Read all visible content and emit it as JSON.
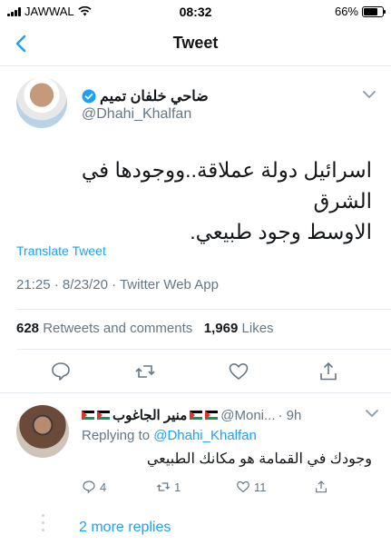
{
  "status_bar": {
    "carrier": "JAWWAL",
    "time": "08:32",
    "battery": "66%",
    "battery_level": 0.66
  },
  "nav": {
    "title": "Tweet"
  },
  "tweet": {
    "author_name": "ضاحي خلفان تميم",
    "author_handle": "@Dhahi_Khalfan",
    "text_line1": "اسرائيل دولة عملاقة..ووجودها في الشرق",
    "text_line2": "الاوسط وجود طبيعي.",
    "translate": "Translate Tweet",
    "meta": "21:25 · 8/23/20 · Twitter Web App",
    "retweets_count": "628",
    "retweets_label": "Retweets and comments",
    "likes_count": "1,969",
    "likes_label": "Likes"
  },
  "reply": {
    "author_name": "منير الجاغوب",
    "handle": "@Moni...",
    "age": "· 9h",
    "replying_prefix": "Replying to",
    "replying_handle": "@Dhahi_Khalfan",
    "text": "وجودك في القمامة هو مكانك الطبيعي",
    "comments": "4",
    "retweets": "1",
    "likes": "11"
  },
  "more_replies": "2 more replies",
  "colors": {
    "accent": "#1da1f2",
    "secondary_text": "#657786",
    "divider": "#e6ecf0"
  }
}
